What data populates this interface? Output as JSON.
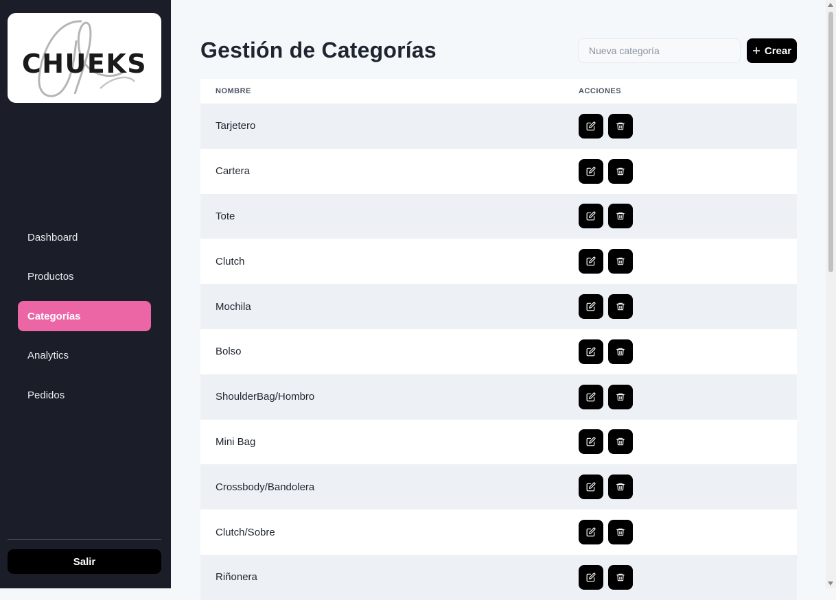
{
  "brand": {
    "logo_text": "CHUEKS"
  },
  "sidebar": {
    "items": [
      {
        "label": "Dashboard",
        "active": false
      },
      {
        "label": "Productos",
        "active": false
      },
      {
        "label": "Categorías",
        "active": true
      },
      {
        "label": "Analytics",
        "active": false
      },
      {
        "label": "Pedidos",
        "active": false
      }
    ],
    "logout_label": "Salir"
  },
  "header": {
    "title": "Gestión de Categorías",
    "new_category_placeholder": "Nueva categoría",
    "create_label": "Crear"
  },
  "table": {
    "columns": [
      "NOMBRE",
      "ACCIONES"
    ],
    "rows": [
      "Tarjetero",
      "Cartera",
      "Tote",
      "Clutch",
      "Mochila",
      "Bolso",
      "ShoulderBag/Hombro",
      "Mini Bag",
      "Crossbody/Bandolera",
      "Clutch/Sobre",
      "Riñonera"
    ],
    "row_actions": [
      "edit-icon",
      "trash-icon"
    ]
  },
  "colors": {
    "sidebar_bg": "#1b1d29",
    "accent_pink": "#ec66a6",
    "button_black": "#000000",
    "row_stripe": "#edf1f5"
  }
}
